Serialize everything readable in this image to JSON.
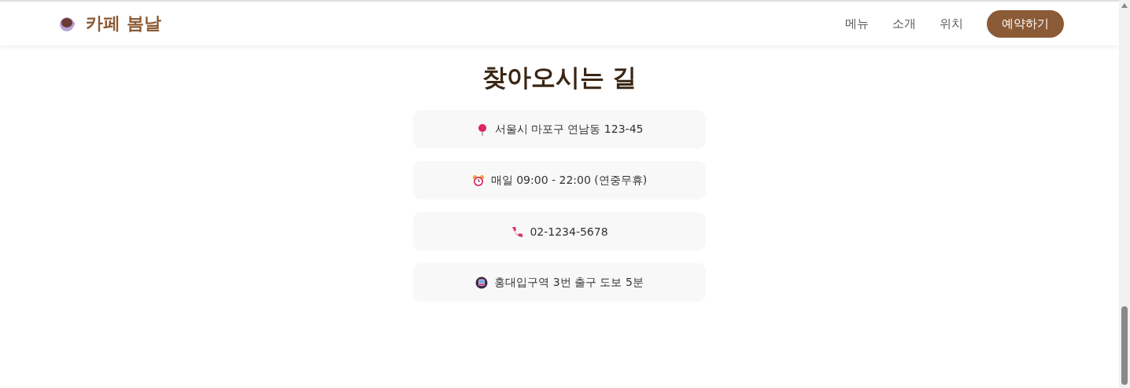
{
  "header": {
    "logo": "카페 봄날",
    "nav": [
      {
        "label": "메뉴"
      },
      {
        "label": "소개"
      },
      {
        "label": "위치"
      }
    ],
    "cta": "예약하기"
  },
  "section": {
    "title": "찾아오시는 길",
    "items": [
      {
        "kind": "pin",
        "text": "서울시 마포구 연남동 123-45"
      },
      {
        "kind": "clock",
        "text": "매일 09:00 - 22:00 (연중무휴)"
      },
      {
        "kind": "phone",
        "text": "02-1234-5678"
      },
      {
        "kind": "metro",
        "text": "홍대입구역 3번 출구 도보 5분"
      }
    ]
  }
}
